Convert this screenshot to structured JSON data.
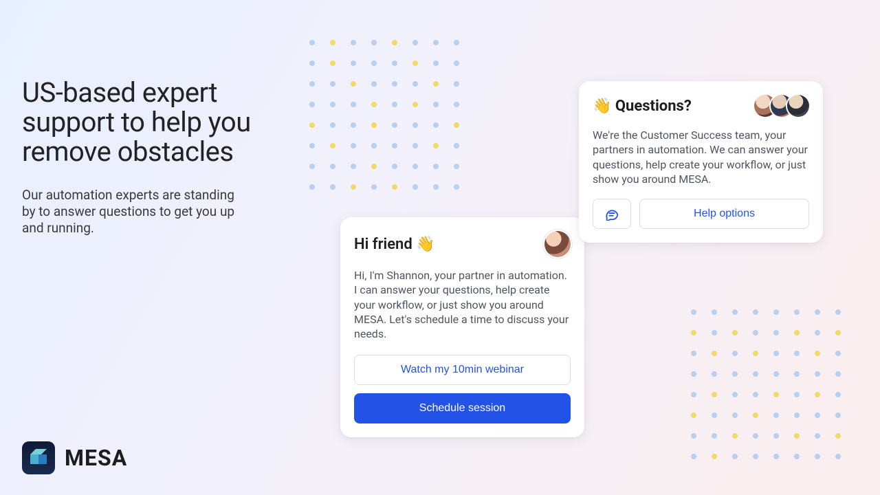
{
  "headline": "US-based expert support to help you remove obstacles",
  "subhead": "Our automation experts are standing by to answer questions to get you up and running.",
  "brand": {
    "name": "MESA"
  },
  "shannon_card": {
    "title": "Hi friend 👋",
    "body": "Hi, I'm Shannon, your partner in automation. I can answer your questions, help create your workflow, or just show you around MESA. Let's schedule a time to discuss your needs.",
    "watch_label": "Watch my 10min webinar",
    "schedule_label": "Schedule session"
  },
  "questions_card": {
    "title": "👋 Questions?",
    "body": "We're the Customer Success team, your partners in automation. We can answer your questions, help create your workflow, or just show you around MESA.",
    "help_label": "Help options"
  }
}
